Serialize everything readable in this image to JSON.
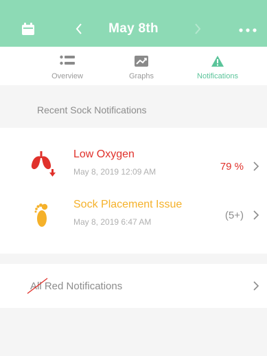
{
  "header": {
    "title": "May 8th"
  },
  "tabs": [
    {
      "label": "Overview",
      "icon": "list-icon",
      "active": false
    },
    {
      "label": "Graphs",
      "icon": "chart-icon",
      "active": false
    },
    {
      "label": "Notifications",
      "icon": "warning-icon",
      "active": true
    }
  ],
  "section": {
    "title": "Recent Sock Notifications"
  },
  "notifications": [
    {
      "title": "Low Oxygen",
      "timestamp": "May 8, 2019  12:09 AM",
      "value": "79 %",
      "icon": "lungs-icon",
      "color": "#e0312b"
    },
    {
      "title": "Sock Placement Issue",
      "timestamp": "May 8, 2019  6:47 AM",
      "value": "(5+)",
      "icon": "foot-icon",
      "color": "#f5b12a"
    }
  ],
  "all_red": {
    "label": "All Red Notifications"
  },
  "colors": {
    "header": "#8ddab5",
    "accent": "#5bc49a",
    "red": "#e0312b",
    "yellow": "#f5b12a"
  }
}
